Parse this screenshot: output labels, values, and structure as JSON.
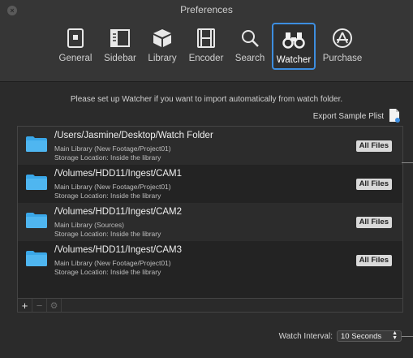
{
  "window": {
    "title": "Preferences"
  },
  "toolbar": {
    "items": [
      {
        "label": "General",
        "icon": "general-icon"
      },
      {
        "label": "Sidebar",
        "icon": "sidebar-icon"
      },
      {
        "label": "Library",
        "icon": "library-box-icon"
      },
      {
        "label": "Encoder",
        "icon": "film-icon"
      },
      {
        "label": "Search",
        "icon": "search-icon"
      },
      {
        "label": "Watcher",
        "icon": "binoculars-icon",
        "selected": true
      },
      {
        "label": "Purchase",
        "icon": "app-store-icon"
      }
    ]
  },
  "main": {
    "intro": "Please set up Watcher if you want to import automatically from watch folder.",
    "export_label": "Export Sample Plist",
    "watch_interval_label": "Watch Interval:",
    "watch_interval_value": "10 Seconds"
  },
  "folders": [
    {
      "path": "/Users/Jasmine/Desktop/Watch Folder",
      "library": "Main Library (New Footage/Project01)",
      "storage": "Storage Location: Inside the library",
      "badge": "All Files"
    },
    {
      "path": "/Volumes/HDD11/Ingest/CAM1",
      "library": "Main Library (New Footage/Project01)",
      "storage": "Storage Location: Inside the library",
      "badge": "All Files"
    },
    {
      "path": "/Volumes/HDD11/Ingest/CAM2",
      "library": "Main Library (Sources)",
      "storage": "Storage Location: Inside the library",
      "badge": "All Files"
    },
    {
      "path": "/Volumes/HDD11/Ingest/CAM3",
      "library": "Main Library (New Footage/Project01)",
      "storage": "Storage Location: Inside the library",
      "badge": "All Files"
    }
  ],
  "list_footer": {
    "add": "+",
    "remove": "−",
    "action": "⚙"
  },
  "colors": {
    "accent": "#3d8ee0",
    "folder": "#3aa7e8"
  }
}
